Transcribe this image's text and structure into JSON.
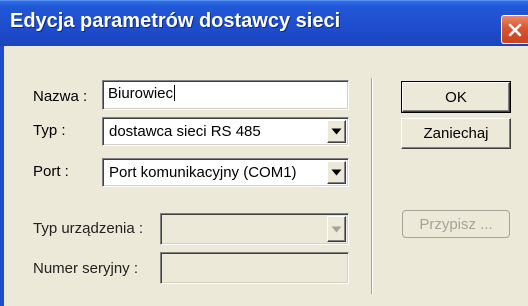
{
  "window": {
    "title": "Edycja parametrów dostawcy sieci",
    "close_icon": "close-icon"
  },
  "form": {
    "name_label": "Nazwa :",
    "name_value": "Biurowiec",
    "type_label": "Typ :",
    "type_value": "dostawca sieci RS 485",
    "port_label": "Port :",
    "port_value": "Port komunikacyjny (COM1)",
    "device_type_label": "Typ urządzenia :",
    "device_type_value": "",
    "serial_label": "Numer seryjny :",
    "serial_value": ""
  },
  "buttons": {
    "ok_label": "OK",
    "cancel_label": "Zaniechaj",
    "assign_label": "Przypisz ..."
  },
  "colors": {
    "titlebar": "#1f4fcf",
    "close": "#d9552f",
    "dialog_bg": "#ece9d8"
  }
}
